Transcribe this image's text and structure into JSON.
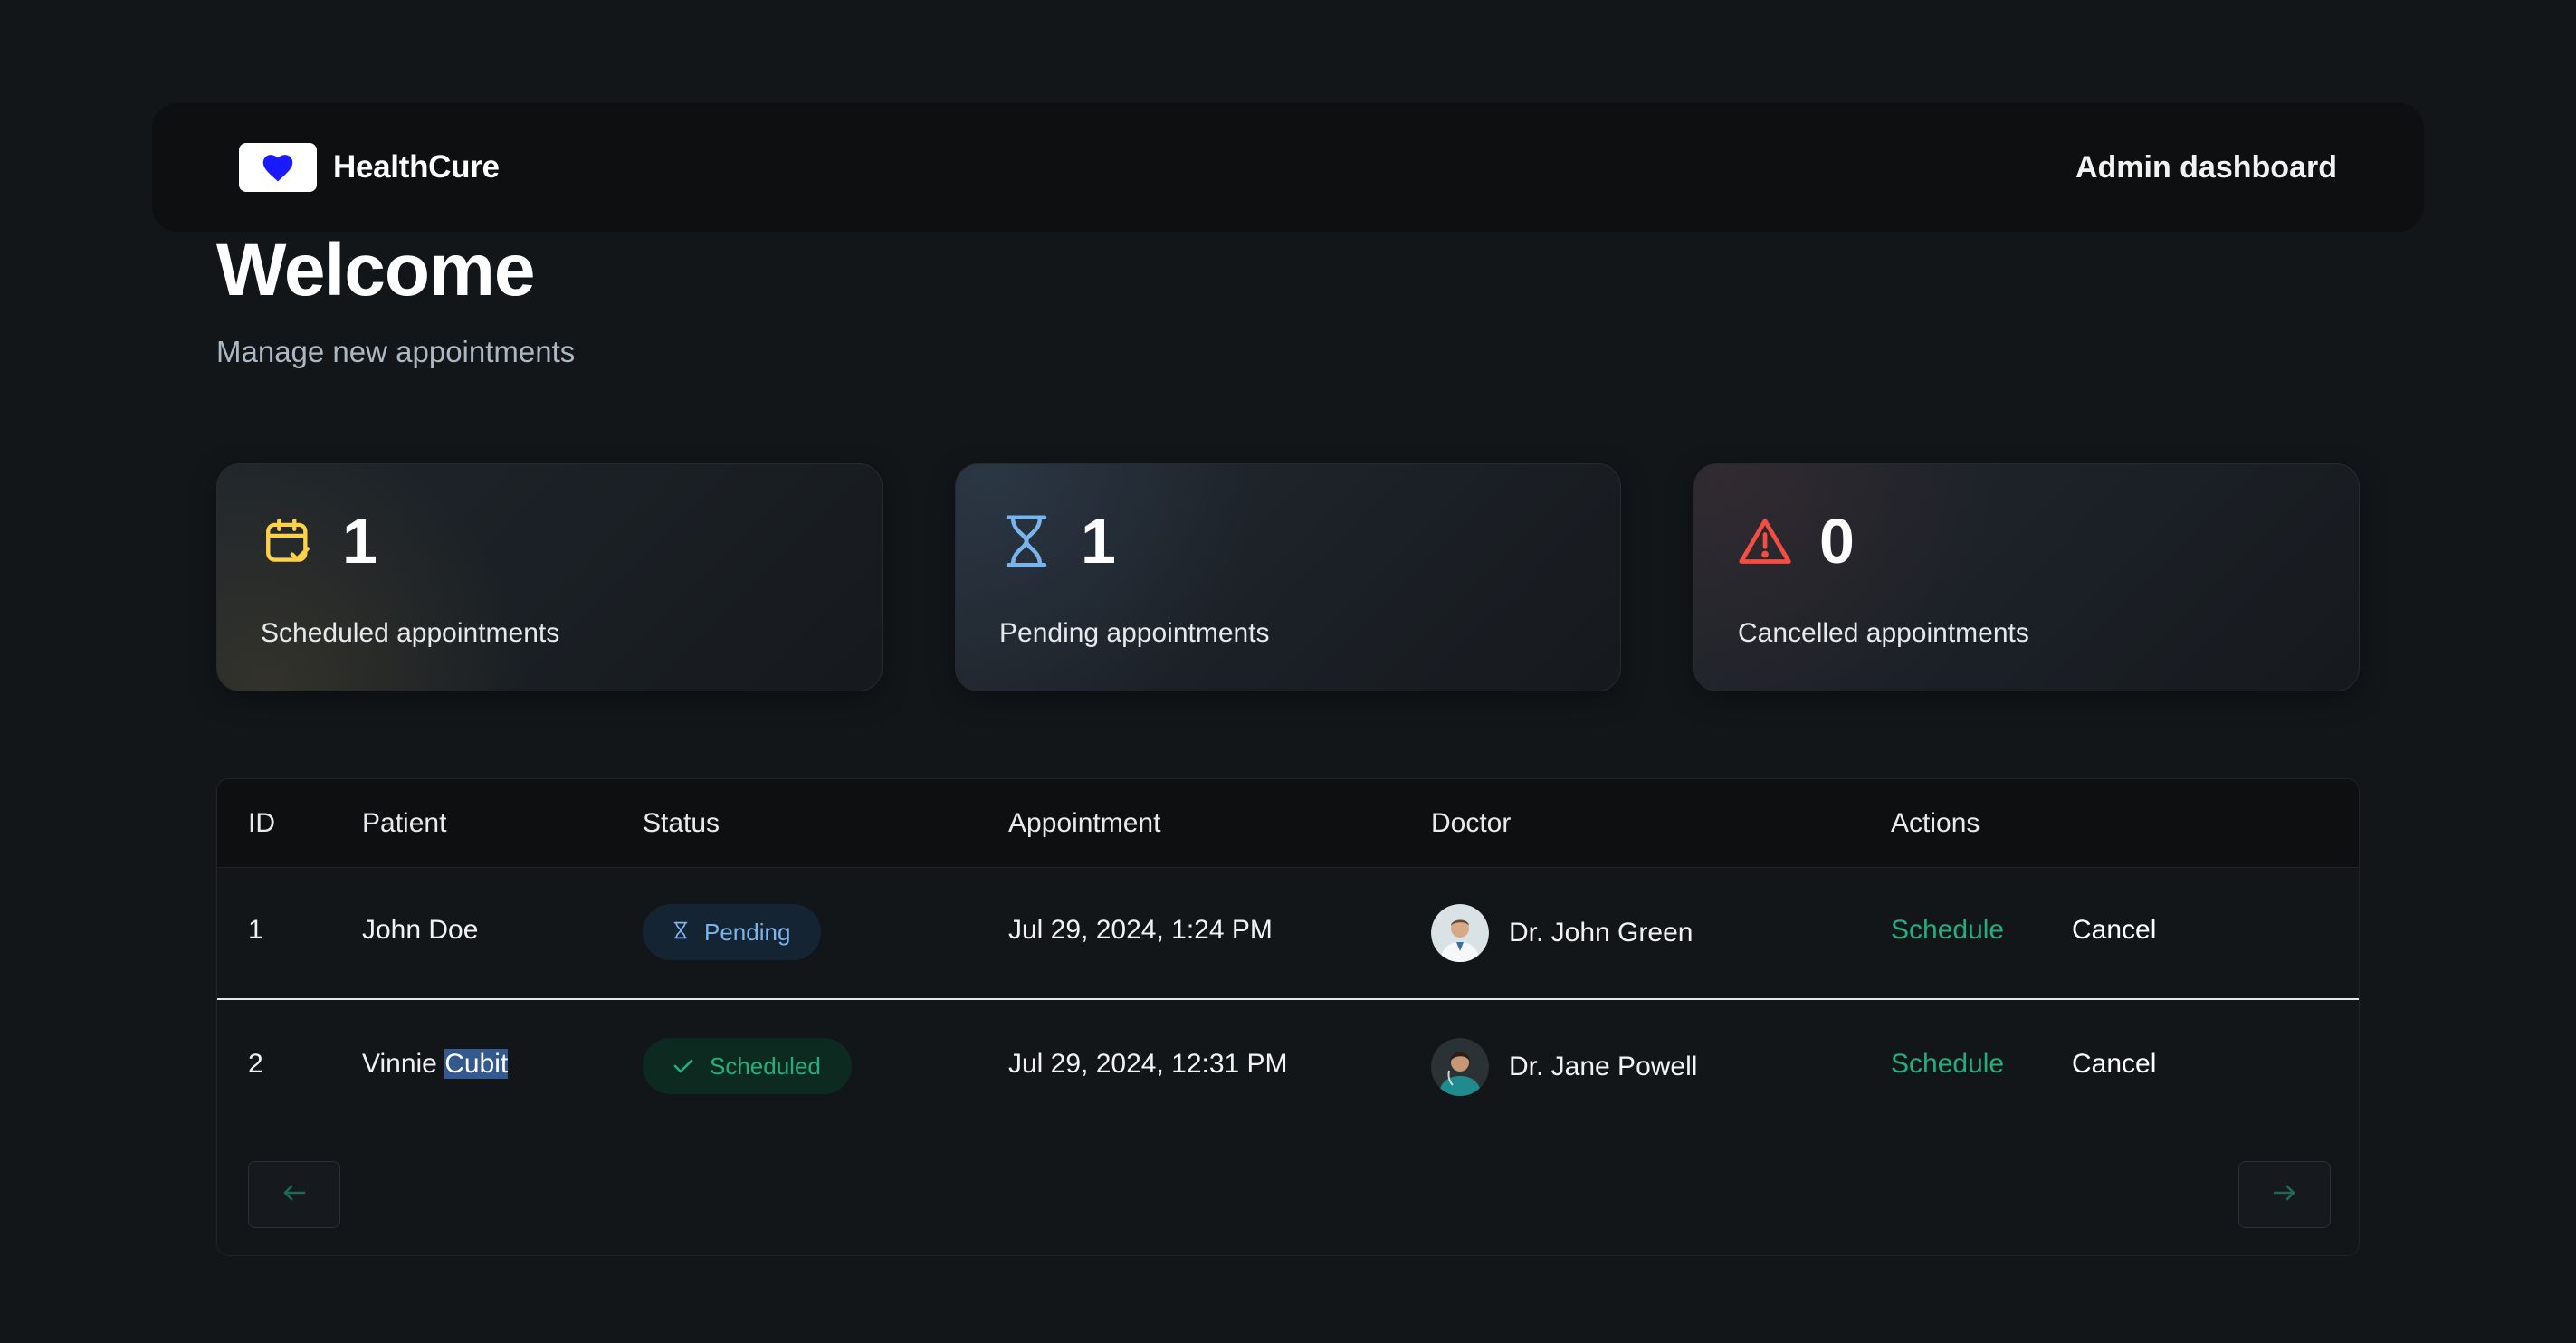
{
  "header": {
    "brand_name": "HealthCure",
    "admin_label": "Admin dashboard"
  },
  "welcome": {
    "title": "Welcome",
    "subtitle": "Manage new appointments"
  },
  "stats": [
    {
      "count": "1",
      "label": "Scheduled appointments",
      "icon": "calendar-check-icon",
      "color": "#ffd147"
    },
    {
      "count": "1",
      "label": "Pending appointments",
      "icon": "hourglass-icon",
      "color": "#79b5ec"
    },
    {
      "count": "0",
      "label": "Cancelled appointments",
      "icon": "alert-triangle-icon",
      "color": "#f24e43"
    }
  ],
  "table": {
    "columns": [
      "ID",
      "Patient",
      "Status",
      "Appointment",
      "Doctor",
      "Actions"
    ],
    "rows": [
      {
        "id": "1",
        "patient": "John Doe",
        "status": "Pending",
        "appointment": "Jul 29, 2024, 1:24 PM",
        "doctor": "Dr. John Green",
        "schedule": "Schedule",
        "cancel": "Cancel"
      },
      {
        "id": "2",
        "patient_first": "Vinnie",
        "patient_last": "Cubit",
        "status": "Scheduled",
        "appointment": "Jul 29, 2024, 12:31 PM",
        "doctor": "Dr. Jane Powell",
        "schedule": "Schedule",
        "cancel": "Cancel"
      }
    ],
    "pagination": {
      "prev_icon": "arrow-left-icon",
      "next_icon": "arrow-right-icon"
    }
  },
  "colors": {
    "background": "#131619",
    "accent_green": "#24ae7c",
    "pending_blue": "#79b5ec",
    "warning_red": "#f24e43",
    "scheduled_yellow": "#ffd147",
    "brand_heart": "#1a1aff"
  }
}
